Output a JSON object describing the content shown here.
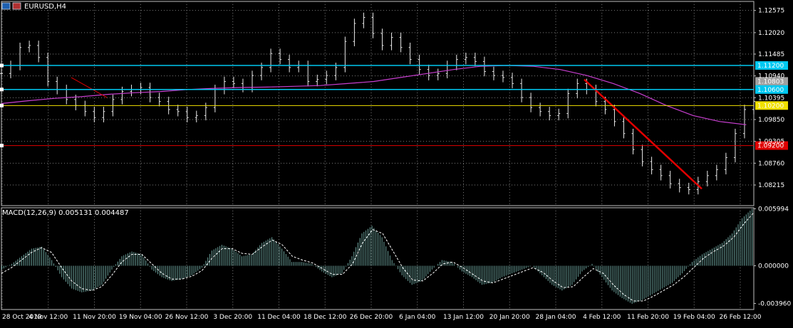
{
  "window": {
    "symbol_title": "EURUSD,H4",
    "indicator_title": "MACD(12,26,9) 0.005131 0.004487"
  },
  "colors": {
    "background": "#000000",
    "grid": "#7a7a7a",
    "candles": "#e8e8e8",
    "ma_line": "#c83fd0",
    "macd_hist": "#6fa6a0",
    "signal_line": "#ffffff",
    "trend_line": "#e00000",
    "level_cyan": "#00c8f0",
    "level_yellow": "#f0e000",
    "level_red": "#e00000",
    "level_gray": "#a0a0a0"
  },
  "chart_data": [
    {
      "type": "line",
      "panel": "price",
      "y_ticks": [
        "1.12575",
        "1.12020",
        "1.11485",
        "1.10940",
        "1.10395",
        "1.09850",
        "1.09305",
        "1.08760",
        "1.08215"
      ],
      "ylim": [
        1.077,
        1.128
      ],
      "x_ticks": [
        "28 Oct 2019",
        "4 Nov 12:00",
        "11 Nov 20:00",
        "19 Nov 04:00",
        "26 Nov 12:00",
        "3 Dec 20:00",
        "11 Dec 04:00",
        "18 Dec 12:00",
        "26 Dec 20:00",
        "6 Jan 04:00",
        "13 Jan 12:00",
        "20 Jan 20:00",
        "28 Jan 04:00",
        "4 Feb 12:00",
        "11 Feb 20:00",
        "19 Feb 04:00",
        "26 Feb 12:00"
      ],
      "price_series": {
        "name": "EURUSD,H4",
        "values": [
          1.11,
          1.112,
          1.1165,
          1.117,
          1.114,
          1.108,
          1.106,
          1.1035,
          1.102,
          1.1005,
          1.099,
          1.1005,
          1.1035,
          1.1055,
          1.106,
          1.1065,
          1.104,
          1.103,
          1.101,
          1.1005,
          1.099,
          1.0995,
          1.1015,
          1.106,
          1.108,
          1.1075,
          1.1065,
          1.1095,
          1.1115,
          1.115,
          1.1135,
          1.1115,
          1.112,
          1.108,
          1.1085,
          1.1095,
          1.1115,
          1.118,
          1.1225,
          1.124,
          1.12,
          1.117,
          1.119,
          1.1165,
          1.1135,
          1.111,
          1.1095,
          1.11,
          1.112,
          1.1135,
          1.114,
          1.113,
          1.1105,
          1.1095,
          1.109,
          1.1075,
          1.104,
          1.1015,
          1.1005,
          1.0995,
          1.1,
          1.105,
          1.1075,
          1.106,
          1.103,
          1.101,
          1.098,
          1.095,
          1.091,
          1.088,
          1.086,
          1.0845,
          1.0825,
          1.0815,
          1.081,
          1.083,
          1.0845,
          1.086,
          1.089,
          1.095,
          1.101,
          1.103
        ]
      },
      "ma_series": {
        "values": [
          1.1025,
          1.1032,
          1.1038,
          1.1042,
          1.1048,
          1.1052,
          1.1055,
          1.106,
          1.1063,
          1.1065,
          1.1066,
          1.1068,
          1.107,
          1.1075,
          1.108,
          1.109,
          1.11,
          1.111,
          1.1118,
          1.112,
          1.1118,
          1.111,
          1.1095,
          1.1075,
          1.105,
          1.102,
          1.0995,
          1.098,
          1.0972
        ]
      },
      "levels": [
        {
          "label": "1.11200",
          "value": 1.112,
          "color": "#00c8f0",
          "label_fill": "#00c8f0"
        },
        {
          "label": "1.10803",
          "value": 1.10803,
          "color": "#a0a0a0",
          "label_fill": "#a0a0a0"
        },
        {
          "label": "1.10600",
          "value": 1.106,
          "color": "#00c8f0",
          "label_fill": "#00c8f0"
        },
        {
          "label": "1.10200",
          "value": 1.102,
          "color": "#f0e000",
          "label_fill": "#f0e000"
        },
        {
          "label": "1.09200",
          "value": 1.092,
          "color": "#e00000",
          "label_fill": "#e00000"
        }
      ],
      "grid": true
    },
    {
      "type": "bar",
      "panel": "macd",
      "y_ticks": [
        "0.005994",
        "0.000000",
        "-0.003960"
      ],
      "ylim": [
        -0.0046,
        0.0061
      ],
      "histogram_values": [
        -0.0004,
        0.0002,
        0.001,
        0.0018,
        0.002,
        0.0006,
        -0.0012,
        -0.0024,
        -0.0028,
        -0.0026,
        -0.002,
        -0.0004,
        0.001,
        0.0015,
        0.0012,
        -0.0004,
        -0.0012,
        -0.0016,
        -0.0014,
        -0.001,
        -0.0002,
        0.0016,
        0.0022,
        0.0018,
        0.001,
        0.0012,
        0.0024,
        0.003,
        0.0018,
        0.0004,
        0.0004,
        0.0002,
        -0.0006,
        -0.0012,
        -0.0008,
        0.001,
        0.0034,
        0.0042,
        0.003,
        0.0006,
        -0.001,
        -0.002,
        -0.0016,
        -0.0004,
        0.0006,
        0.0004,
        -0.0006,
        -0.0012,
        -0.002,
        -0.0018,
        -0.0012,
        -0.0008,
        -0.0004,
        0.0,
        -0.001,
        -0.002,
        -0.0026,
        -0.002,
        -0.0006,
        0.0002,
        -0.0012,
        -0.0026,
        -0.0034,
        -0.004,
        -0.0036,
        -0.003,
        -0.0024,
        -0.0018,
        -0.0008,
        0.0004,
        0.0012,
        0.0018,
        0.0024,
        0.0034,
        0.005,
        0.006
      ],
      "signal_values": [
        -0.0008,
        -0.0002,
        0.0006,
        0.0014,
        0.0019,
        0.0014,
        -0.0002,
        -0.0016,
        -0.0024,
        -0.0026,
        -0.0022,
        -0.001,
        0.0004,
        0.0012,
        0.0012,
        0.0002,
        -0.0008,
        -0.0014,
        -0.0014,
        -0.0011,
        -0.0005,
        0.0008,
        0.0018,
        0.0018,
        0.0013,
        0.0012,
        0.002,
        0.0027,
        0.0022,
        0.001,
        0.0006,
        0.0003,
        -0.0003,
        -0.0009,
        -0.0009,
        0.0002,
        0.0024,
        0.0038,
        0.0034,
        0.0016,
        -0.0002,
        -0.0015,
        -0.0016,
        -0.0008,
        0.0002,
        0.0004,
        -0.0002,
        -0.0009,
        -0.0016,
        -0.0018,
        -0.0014,
        -0.001,
        -0.0006,
        -0.0002,
        -0.0007,
        -0.0016,
        -0.0023,
        -0.0022,
        -0.0012,
        -0.0003,
        -0.0008,
        -0.002,
        -0.003,
        -0.0037,
        -0.0037,
        -0.0032,
        -0.0026,
        -0.002,
        -0.0012,
        -0.0002,
        0.0008,
        0.0015,
        0.0021,
        0.003,
        0.0044,
        0.0056
      ]
    }
  ]
}
